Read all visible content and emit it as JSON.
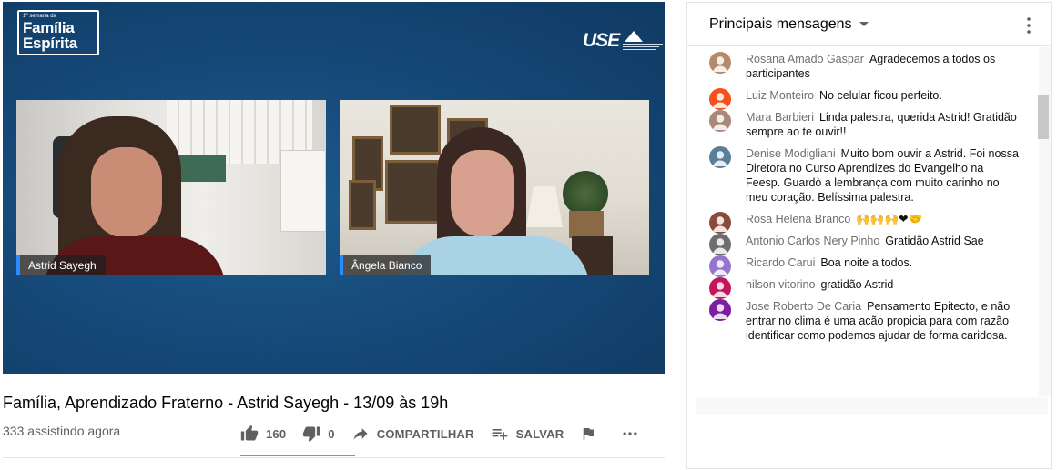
{
  "video": {
    "logo_left_small": "1ª semana da",
    "logo_left_line1": "Família",
    "logo_left_line2": "Espírita",
    "logo_right": "USE",
    "participants": [
      {
        "name": "Astrid Sayegh"
      },
      {
        "name": "Ângela Bianco"
      }
    ]
  },
  "info": {
    "title": "Família, Aprendizado Fraterno - Astrid Sayegh - 13/09 às 19h",
    "views": "333 assistindo agora",
    "likes": "160",
    "dislikes": "0",
    "share_label": "COMPARTILHAR",
    "save_label": "SALVAR"
  },
  "chat": {
    "header": "Principais mensagens",
    "messages": [
      {
        "author": "Rosana Amado Gaspar",
        "text": "Agradecemos a todos os participantes",
        "avatar_color": "#b58a6a"
      },
      {
        "author": "Luiz Monteiro",
        "text": "No celular ficou perfeito.",
        "avatar_color": "#f4511e"
      },
      {
        "author": "Mara Barbieri",
        "text": "Linda palestra, querida Astrid! Gratidão sempre ao te ouvir!!",
        "avatar_color": "#a98a7a"
      },
      {
        "author": "Denise Modigliani",
        "text": "Muito bom ouvir a Astrid. Foi nossa Diretora no Curso Aprendizes do Evangelho na Feesp. Guardò a lembrança com muito carinho no meu coração. Belíssima palestra.",
        "avatar_color": "#5a7f9a"
      },
      {
        "author": "Rosa Helena Branco",
        "text": "🙌🙌🙌❤🤝",
        "avatar_color": "#8a4a3a"
      },
      {
        "author": "Antonio Carlos Nery Pinho",
        "text": "Gratidão Astrid Sae",
        "avatar_color": "#6e6e6e"
      },
      {
        "author": "Ricardo Carui",
        "text": "Boa noite a todos.",
        "avatar_color": "#9575cd"
      },
      {
        "author": "nilson vitorino",
        "text": "gratidão Astrid",
        "avatar_color": "#c2185b"
      },
      {
        "author": "Jose Roberto De Caria",
        "text": "Pensamento Epitecto, e não entrar no clima é uma acão propicia para com razão identificar como podemos ajudar de forma caridosa.",
        "avatar_color": "#7b1fa2"
      }
    ]
  },
  "colors": {
    "video_bg": "#164a7a",
    "name_accent": "#2a8cff",
    "icon_gray": "#606060"
  },
  "icons": [
    "like-icon",
    "dislike-icon",
    "share-icon",
    "save-playlist-icon",
    "flag-icon",
    "more-icon",
    "caret-down-icon",
    "kebab-menu-icon"
  ]
}
